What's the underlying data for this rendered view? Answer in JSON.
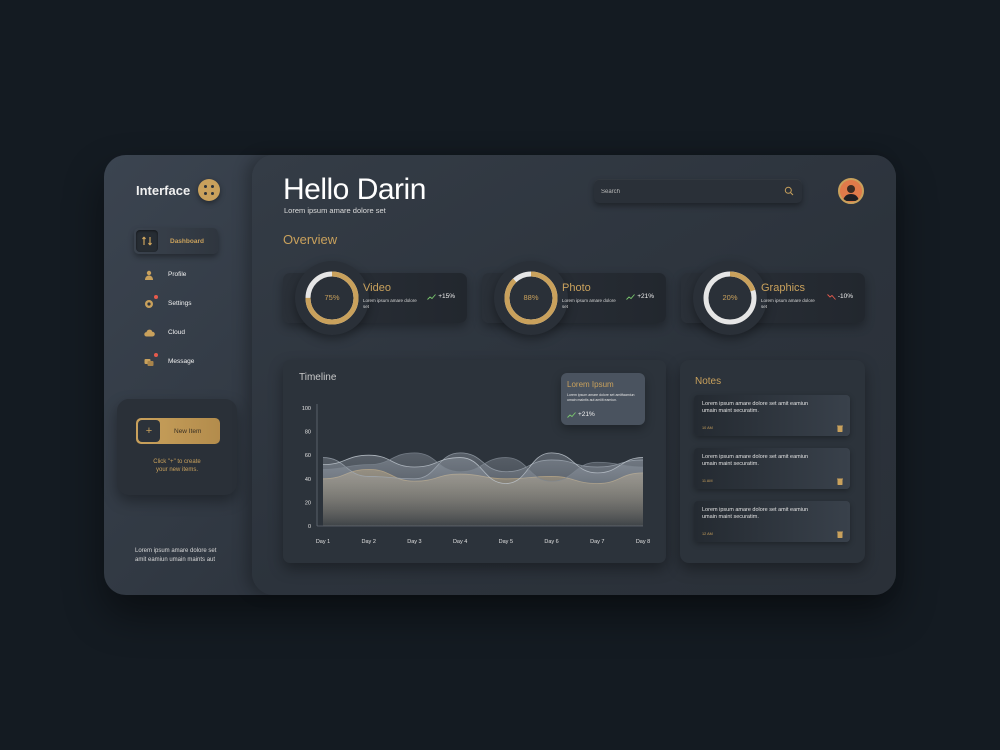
{
  "colors": {
    "accent": "#c9a15c",
    "background": "#141b22",
    "up": "#7bc96f",
    "down": "#e65a4c"
  },
  "sidebar": {
    "brand": "Interface",
    "items": [
      {
        "label": "Dashboard",
        "icon": "dashboard-icon",
        "active": true
      },
      {
        "label": "Profile",
        "icon": "user-icon"
      },
      {
        "label": "Settings",
        "icon": "gear-icon"
      },
      {
        "label": "Cloud",
        "icon": "cloud-icon"
      },
      {
        "label": "Message",
        "icon": "message-icon"
      }
    ],
    "new_item": {
      "button_label": "New Item",
      "plus": "+",
      "hint_line1": "Click \"+\" to create",
      "hint_line2": "your new items."
    },
    "footer_line1": "Lorem ipsum amare dolore set",
    "footer_line2": "amit eamiun umain maints aut"
  },
  "header": {
    "greeting": "Hello Darin",
    "subtitle": "Lorem ipsum amare dolore set",
    "search_placeholder": "Search"
  },
  "overview": {
    "title": "Overview",
    "stats": [
      {
        "title": "Video",
        "percent": "75%",
        "fill": 0.75,
        "desc": "Lorem ipsum amare dolore set",
        "change": "+15%",
        "trend": "up"
      },
      {
        "title": "Photo",
        "percent": "88%",
        "fill": 0.88,
        "desc": "Lorem ipsum amare dolore set",
        "change": "+21%",
        "trend": "up"
      },
      {
        "title": "Graphics",
        "percent": "20%",
        "fill": 0.2,
        "desc": "Lorem ipsum amare dolore set",
        "change": "-10%",
        "trend": "down"
      }
    ]
  },
  "timeline": {
    "title": "Timeline",
    "popup": {
      "title": "Lorem Ipsum",
      "desc": "Lorem ipsum amare dolore set amitfaamiun umain maintis aut amiilt eamiun.",
      "change": "+21%"
    }
  },
  "chart_data": {
    "type": "area",
    "title": "Timeline",
    "categories": [
      "Day 1",
      "Day 2",
      "Day 3",
      "Day 4",
      "Day 5",
      "Day 6",
      "Day 7",
      "Day 8"
    ],
    "yticks": [
      100,
      80,
      60,
      40,
      20,
      0
    ],
    "ylim": [
      0,
      100
    ],
    "series": [
      {
        "values": [
          40,
          48,
          38,
          44,
          40,
          42,
          36,
          45
        ]
      },
      {
        "values": [
          58,
          42,
          40,
          62,
          46,
          56,
          50,
          56
        ]
      },
      {
        "values": [
          52,
          60,
          50,
          58,
          36,
          62,
          45,
          58
        ]
      },
      {
        "values": [
          48,
          52,
          62,
          46,
          58,
          38,
          54,
          50
        ]
      }
    ]
  },
  "notes": {
    "title": "Notes",
    "items": [
      {
        "text": "Lorem ipsum amare dolore set amit eamiun umain maint securatim.",
        "time": "10 AM"
      },
      {
        "text": "Lorem ipsum amare dolore set amit eamiun umain maint securatim.",
        "time": "11 AM"
      },
      {
        "text": "Lorem ipsum amare dolore set amit eamiun umain maint securatim.",
        "time": "12 AM"
      }
    ]
  }
}
